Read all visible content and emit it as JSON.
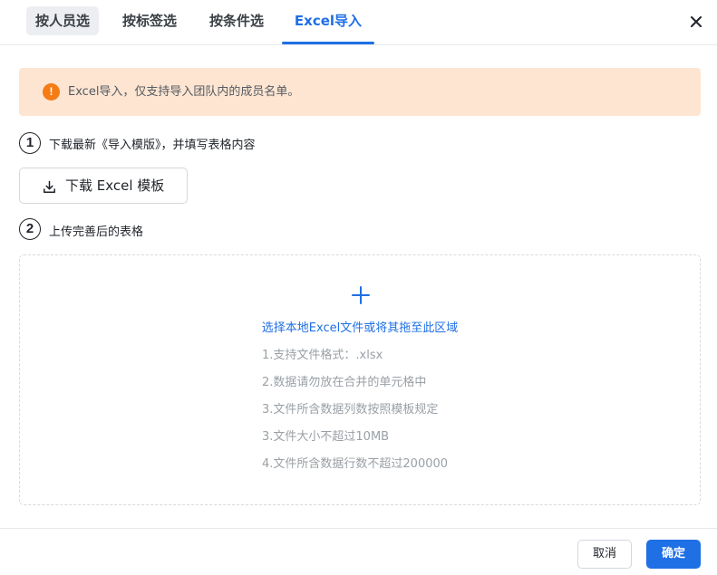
{
  "tabs": [
    {
      "label": "按人员选"
    },
    {
      "label": "按标签选"
    },
    {
      "label": "按条件选"
    },
    {
      "label": "Excel导入"
    }
  ],
  "active_tab": "Excel导入",
  "accent_color": "#1f6fe5",
  "alert": {
    "icon": "exclamation-icon",
    "icon_glyph": "!",
    "text": "Excel导入，仅支持导入团队内的成员名单。",
    "background": "#fde5d2",
    "icon_color": "#f57b14"
  },
  "steps": [
    {
      "number": "1",
      "text": "下载最新《导入模版》，并填写表格内容"
    },
    {
      "number": "2",
      "text": "上传完善后的表格"
    }
  ],
  "download_button": {
    "label": "下载 Excel 模板",
    "icon": "download-icon"
  },
  "upload": {
    "icon": "plus-icon",
    "link_text": "选择本地Excel文件或将其拖至此区域",
    "rules": [
      "1.支持文件格式：.xlsx",
      "2.数据请勿放在合并的单元格中",
      "3.文件所含数据列数按照模板规定",
      "3.文件大小不超过10MB",
      "4.文件所含数据行数不超过200000"
    ]
  },
  "footer": {
    "cancel_label": "取消",
    "confirm_label": "确定"
  }
}
